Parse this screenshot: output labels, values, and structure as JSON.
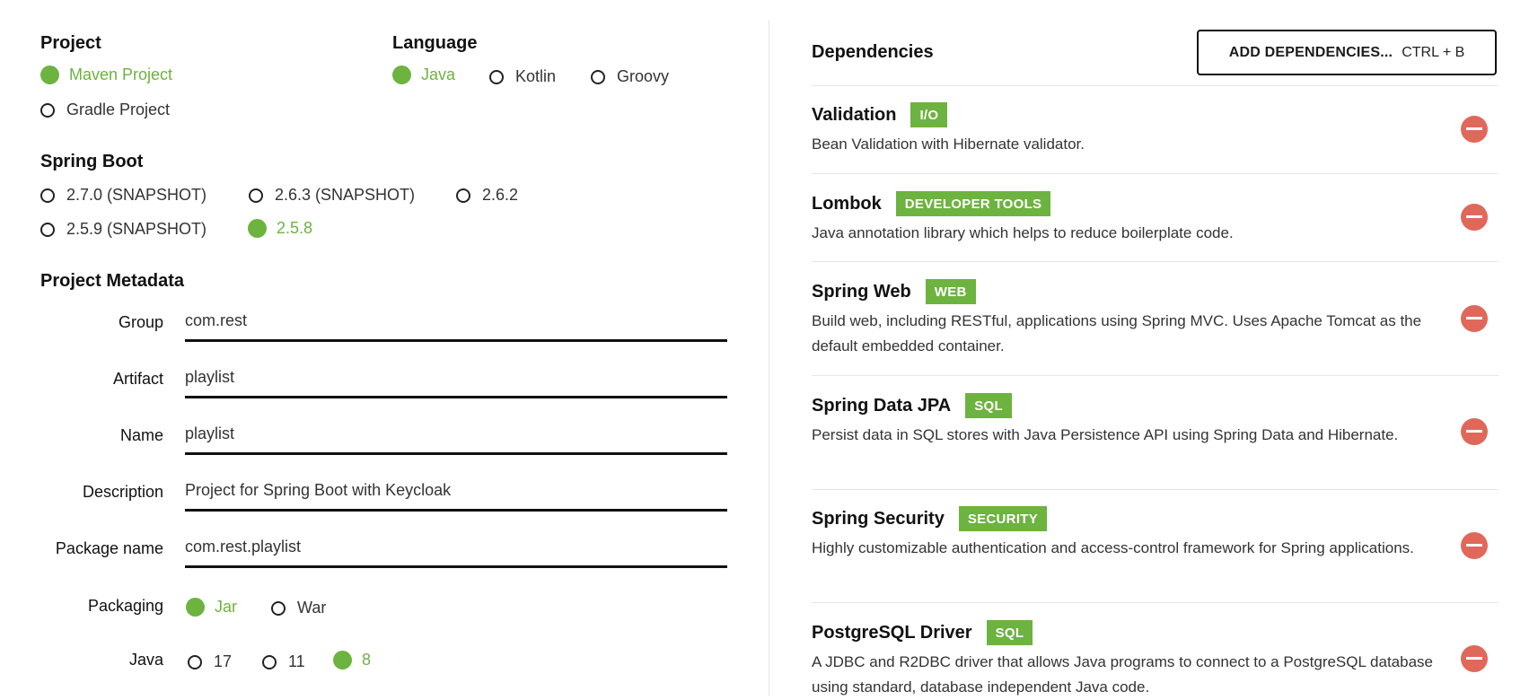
{
  "project": {
    "title": "Project",
    "options": [
      {
        "label": "Maven Project",
        "selected": true
      },
      {
        "label": "Gradle Project",
        "selected": false
      }
    ]
  },
  "language": {
    "title": "Language",
    "options": [
      {
        "label": "Java",
        "selected": true
      },
      {
        "label": "Kotlin",
        "selected": false
      },
      {
        "label": "Groovy",
        "selected": false
      }
    ]
  },
  "spring_boot": {
    "title": "Spring Boot",
    "options": [
      {
        "label": "2.7.0 (SNAPSHOT)",
        "selected": false
      },
      {
        "label": "2.6.3 (SNAPSHOT)",
        "selected": false
      },
      {
        "label": "2.6.2",
        "selected": false
      },
      {
        "label": "2.5.9 (SNAPSHOT)",
        "selected": false
      },
      {
        "label": "2.5.8",
        "selected": true
      }
    ]
  },
  "metadata": {
    "title": "Project Metadata",
    "fields": [
      {
        "label": "Group",
        "value": "com.rest"
      },
      {
        "label": "Artifact",
        "value": "playlist"
      },
      {
        "label": "Name",
        "value": "playlist"
      },
      {
        "label": "Description",
        "value": "Project for Spring Boot with Keycloak"
      },
      {
        "label": "Package name",
        "value": "com.rest.playlist"
      }
    ],
    "packaging": {
      "label": "Packaging",
      "options": [
        {
          "label": "Jar",
          "selected": true
        },
        {
          "label": "War",
          "selected": false
        }
      ]
    },
    "java": {
      "label": "Java",
      "options": [
        {
          "label": "17",
          "selected": false
        },
        {
          "label": "11",
          "selected": false
        },
        {
          "label": "8",
          "selected": true
        }
      ]
    }
  },
  "dependencies": {
    "title": "Dependencies",
    "add_button": {
      "label": "ADD DEPENDENCIES...",
      "shortcut": "CTRL + B"
    },
    "items": [
      {
        "name": "Validation",
        "tag": "I/O",
        "desc": "Bean Validation with Hibernate validator."
      },
      {
        "name": "Lombok",
        "tag": "DEVELOPER TOOLS",
        "desc": "Java annotation library which helps to reduce boilerplate code."
      },
      {
        "name": "Spring Web",
        "tag": "WEB",
        "desc": "Build web, including RESTful, applications using Spring MVC. Uses Apache Tomcat as the default embedded container."
      },
      {
        "name": "Spring Data JPA",
        "tag": "SQL",
        "desc": "Persist data in SQL stores with Java Persistence API using Spring Data and Hibernate."
      },
      {
        "name": "Spring Security",
        "tag": "SECURITY",
        "desc": "Highly customizable authentication and access-control framework for Spring applications."
      },
      {
        "name": "PostgreSQL Driver",
        "tag": "SQL",
        "desc": "A JDBC and R2DBC driver that allows Java programs to connect to a PostgreSQL database using standard, database independent Java code."
      }
    ]
  },
  "colors": {
    "accent": "#6db33f",
    "remove": "#e0685a"
  }
}
